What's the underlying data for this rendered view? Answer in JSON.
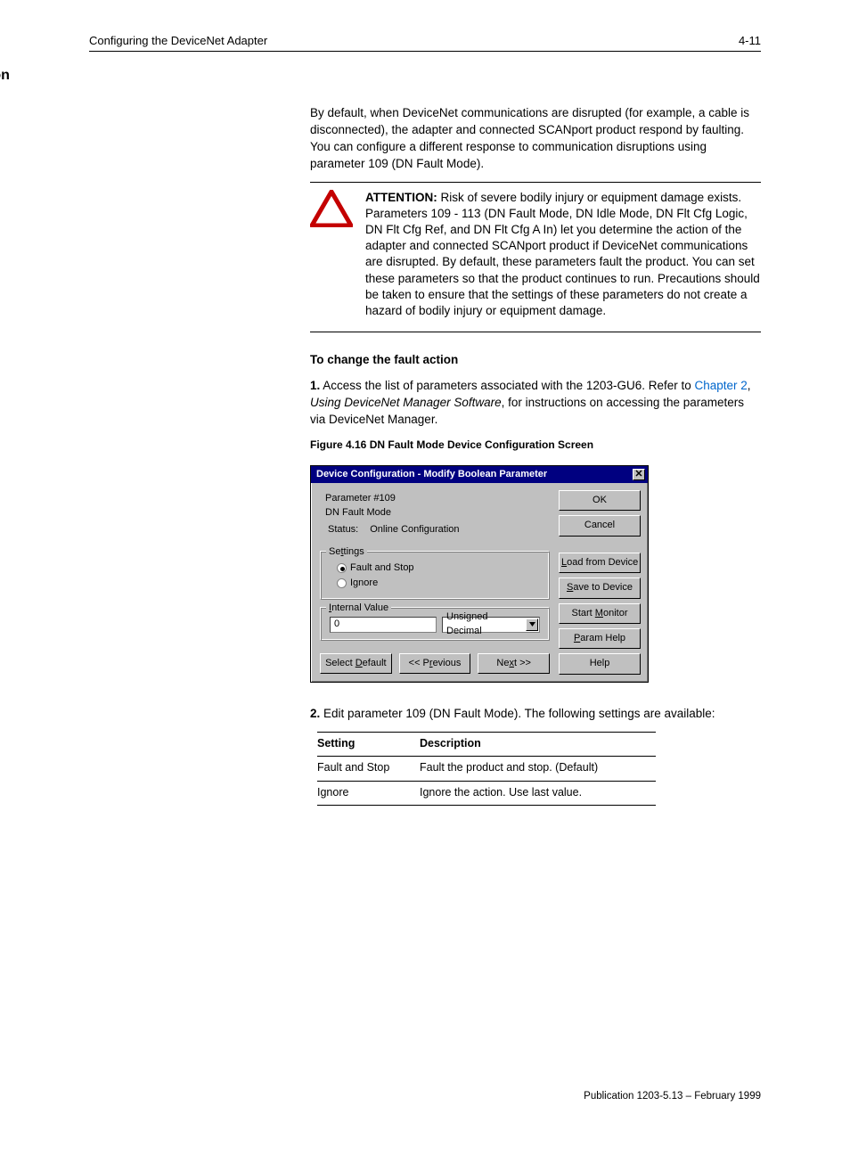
{
  "header": {
    "chapter": "Configuring the DeviceNet Adapter",
    "page": "4-11"
  },
  "section_title": "Setting the Fault Action",
  "intro": "By default, when DeviceNet communications are disrupted (for example, a cable is disconnected), the adapter and connected SCANport product respond by faulting. You can configure a different response to communication disruptions using parameter 109 (DN Fault Mode).",
  "attention": {
    "label": "ATTENTION:",
    "body": "Risk of severe bodily injury or equipment damage exists. Parameters 109 - 113 (DN Fault Mode, DN Idle Mode, DN Flt Cfg Logic, DN Flt Cfg Ref, and DN Flt Cfg A In) let you determine the action of the adapter and connected SCANport product if DeviceNet communications are disrupted. By default, these parameters fault the product. You can set these parameters so that the product continues to run. Precautions should be taken to ensure that the settings of these parameters do not create a hazard of bodily injury or equipment damage."
  },
  "changing_heading": "To change the fault action",
  "changing_step": {
    "prefix": "1.",
    "body_before": "Access the list of parameters associated with the 1203-GU6. Refer to ",
    "link": "Chapter 2",
    "body_mid": ", ",
    "emph": "Using DeviceNet Manager Software",
    "body_after": ",  for instructions on accessing the parameters via DeviceNet Manager."
  },
  "figure_line": "Figure 4.16 DN Fault Mode Device Configuration Screen",
  "edit_step": {
    "prefix": "2.",
    "body": "Edit parameter 109 (DN Fault Mode). The following settings are available:"
  },
  "table": {
    "headers": [
      "Setting",
      "Description"
    ],
    "rows": [
      [
        "Fault and Stop",
        "Fault the product and stop. (Default)"
      ],
      [
        "Ignore",
        "Ignore the action. Use last value."
      ]
    ]
  },
  "dialog": {
    "title": "Device Configuration - Modify Boolean Parameter",
    "info": {
      "line1": "Parameter #109",
      "line2": "DN Fault Mode",
      "status_label": "Status:",
      "status_value": "Online Configuration"
    },
    "settings": {
      "legend_pre": "Se",
      "legend_ul": "t",
      "legend_post": "tings",
      "opt1": "Fault and Stop",
      "opt2": "Ignore"
    },
    "internal_value": {
      "legend_ul": "I",
      "legend_post": "nternal Value",
      "value": "0",
      "format": "Unsigned Decimal"
    },
    "buttons_left": {
      "select_default_pre": "Select ",
      "select_default_ul": "D",
      "select_default_post": "efault",
      "prev_pre": "<< P",
      "prev_ul": "r",
      "prev_post": "evious",
      "next_pre": "Ne",
      "next_ul": "x",
      "next_post": "t >>"
    },
    "buttons_right": {
      "ok": "OK",
      "cancel": "Cancel",
      "load_ul": "L",
      "load_post": "oad from Device",
      "save_ul": "S",
      "save_post": "ave to Device",
      "start_pre": "Start ",
      "start_ul": "M",
      "start_post": "onitor",
      "param_ul": "P",
      "param_post": "aram Help",
      "help": "Help"
    }
  },
  "footer": "Publication 1203-5.13 – February 1999"
}
